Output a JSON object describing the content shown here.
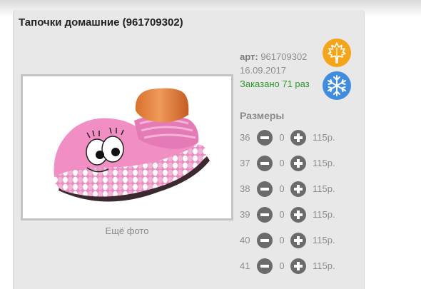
{
  "product": {
    "title": "Тапочки домашние (961709302)",
    "photo_alt": "Тапочки домашние",
    "more_photos": "Ещё фото"
  },
  "meta": {
    "sku_label": "арт:",
    "sku": "961709302",
    "date": "16.09.2017",
    "ordered": "Заказано 71 раз"
  },
  "season_icons": [
    {
      "name": "autumn",
      "icon": "maple-leaf-icon",
      "color": "#f5a517"
    },
    {
      "name": "winter",
      "icon": "snowflake-icon",
      "color": "#3e8de0"
    }
  ],
  "sizes": {
    "heading": "Размеры",
    "rows": [
      {
        "size": "36",
        "qty": "0",
        "price": "115р."
      },
      {
        "size": "37",
        "qty": "0",
        "price": "115р."
      },
      {
        "size": "38",
        "qty": "0",
        "price": "115р."
      },
      {
        "size": "39",
        "qty": "0",
        "price": "115р."
      },
      {
        "size": "40",
        "qty": "0",
        "price": "115р."
      },
      {
        "size": "41",
        "qty": "0",
        "price": "115р."
      }
    ]
  }
}
